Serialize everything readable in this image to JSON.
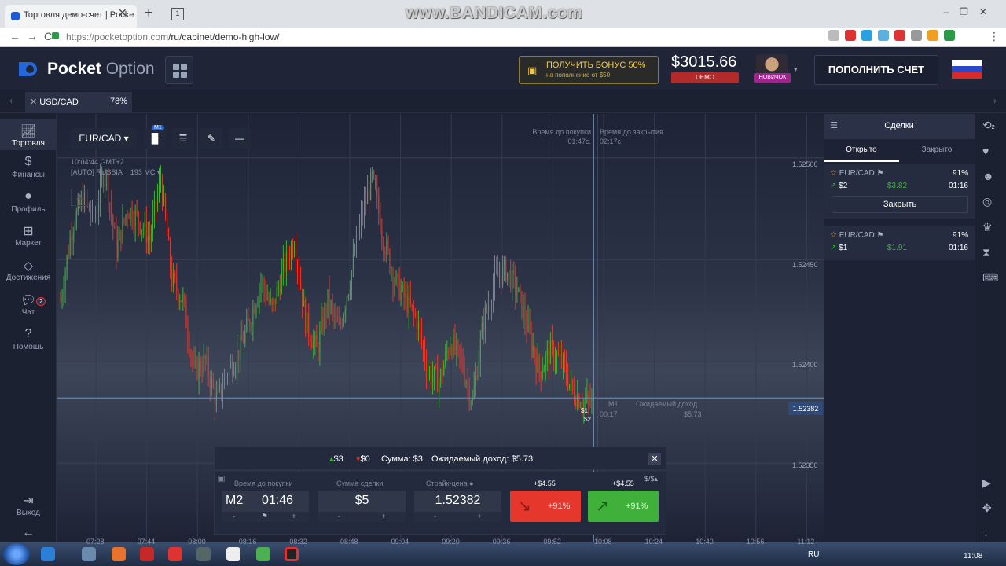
{
  "browser": {
    "tab_title": "Торговля демо-счет | Pocke",
    "url_host": "https://pocketoption.com",
    "url_path": "/ru/cabinet/demo-high-low/",
    "tab_count": "1",
    "recorder_watermark": "www.BANDICAM.com"
  },
  "header": {
    "logo_bold": "Pocket",
    "logo_thin": "Option",
    "bonus_title": "ПОЛУЧИТЬ БОНУС 50%",
    "bonus_sub": "на пополнение от $50",
    "balance": "$3015.66",
    "account_type": "DEMO",
    "rank": "НОВИЧОК",
    "deposit_button": "ПОПОЛНИТЬ СЧЕТ"
  },
  "assetbar": {
    "asset": "USD/CAD",
    "payout": "78%"
  },
  "sidebar": {
    "items": [
      {
        "label": "Торговля",
        "icon": "chart-line-icon"
      },
      {
        "label": "Финансы",
        "icon": "dollar-icon"
      },
      {
        "label": "Профиль",
        "icon": "user-icon"
      },
      {
        "label": "Маркет",
        "icon": "cart-icon"
      },
      {
        "label": "Достижения",
        "icon": "diamond-icon"
      },
      {
        "label": "Чат",
        "icon": "chat-icon"
      },
      {
        "label": "Помощь",
        "icon": "help-icon"
      }
    ],
    "chat_badge": "2",
    "logout": "Выход"
  },
  "chart": {
    "pair": "EUR/CAD",
    "timeframe_badge": "M1",
    "server_time": "10:04:44 GMT+2",
    "region": "[AUTO] RUSSIA",
    "ping": "193 МС",
    "auto_label": "A",
    "purchase_time_label": "Время до покупки",
    "purchase_time_value": "01:47с.",
    "close_time_label": "Время до закрытия",
    "close_time_value": "02:17с.",
    "expiry_tf": "M1",
    "expiry_time": "00:17",
    "expected_label": "Ожидаемый доход",
    "expected_value": "$5.73",
    "current_price": "1.52382",
    "marker_1": "$1",
    "marker_2": "$2",
    "price_ticks": [
      "1.52500",
      "1.52450",
      "1.52400",
      "1.52350"
    ],
    "time_ticks": [
      "07:28",
      "07:44",
      "08:00",
      "08:16",
      "08:32",
      "08:48",
      "09:04",
      "09:20",
      "09:36",
      "09:52",
      "10:08",
      "10:24",
      "10:40",
      "10:56",
      "11:12"
    ],
    "bull_color": "#3fb13b",
    "bear_color": "#e6372d"
  },
  "chart_data": {
    "type": "candlestick",
    "timeframe": "M1",
    "current_price": 1.52382,
    "ylim": [
      1.5234,
      1.5251
    ],
    "y_ticks": [
      1.525,
      1.5245,
      1.524,
      1.5235
    ],
    "x_ticks": [
      "07:28",
      "07:44",
      "08:00",
      "08:16",
      "08:32",
      "08:48",
      "09:04",
      "09:20",
      "09:36",
      "09:52",
      "10:08",
      "10:24",
      "10:40",
      "10:56",
      "11:12"
    ],
    "series_close_approx": [
      1.5243,
      1.52465,
      1.5248,
      1.5247,
      1.52495,
      1.52455,
      1.52475,
      1.5247,
      1.5246,
      1.5249,
      1.5244,
      1.5243,
      1.52395,
      1.524,
      1.5238,
      1.52395,
      1.52405,
      1.5242,
      1.5244,
      1.52425,
      1.52445,
      1.5246,
      1.5242,
      1.52405,
      1.5243,
      1.52415,
      1.5244,
      1.5247,
      1.5249,
      1.5246,
      1.5244,
      1.5243,
      1.5242,
      1.52395,
      1.5239,
      1.5241,
      1.524,
      1.5238,
      1.5242,
      1.5244,
      1.52445,
      1.52435,
      1.52415,
      1.52395,
      1.52405,
      1.524,
      1.52385,
      1.5238
    ]
  },
  "right_panel": {
    "title": "Сделки",
    "tab_open": "Открыто",
    "tab_closed": "Закрыто",
    "trades": [
      {
        "asset": "EUR/CAD",
        "payout": "91%",
        "amount": "$2",
        "profit": "$3.82",
        "time": "01:16"
      },
      {
        "asset": "EUR/CAD",
        "payout": "91%",
        "amount": "$1",
        "profit": "$1.91",
        "time": "01:16"
      }
    ],
    "close_button": "Закрыть",
    "badge": "2"
  },
  "trade_panel": {
    "summary_up": "$3",
    "summary_down": "$0",
    "summary_total": "Сумма: $3",
    "summary_expected": "Ожидаемый доход: $5.73",
    "time_label": "Время до покупки",
    "time_tf": "M2",
    "time_value": "01:46",
    "amount_label": "Сумма сделки",
    "amount_value": "$5",
    "strike_label": "Страйк-цена",
    "strike_value": "1.52382",
    "put_payout": "+91%",
    "put_profit": "+$4.55",
    "call_payout": "+91%",
    "call_profit": "+$4.55",
    "currency_toggle": "$/$"
  },
  "taskbar": {
    "lang": "RU",
    "time": "11:08"
  }
}
